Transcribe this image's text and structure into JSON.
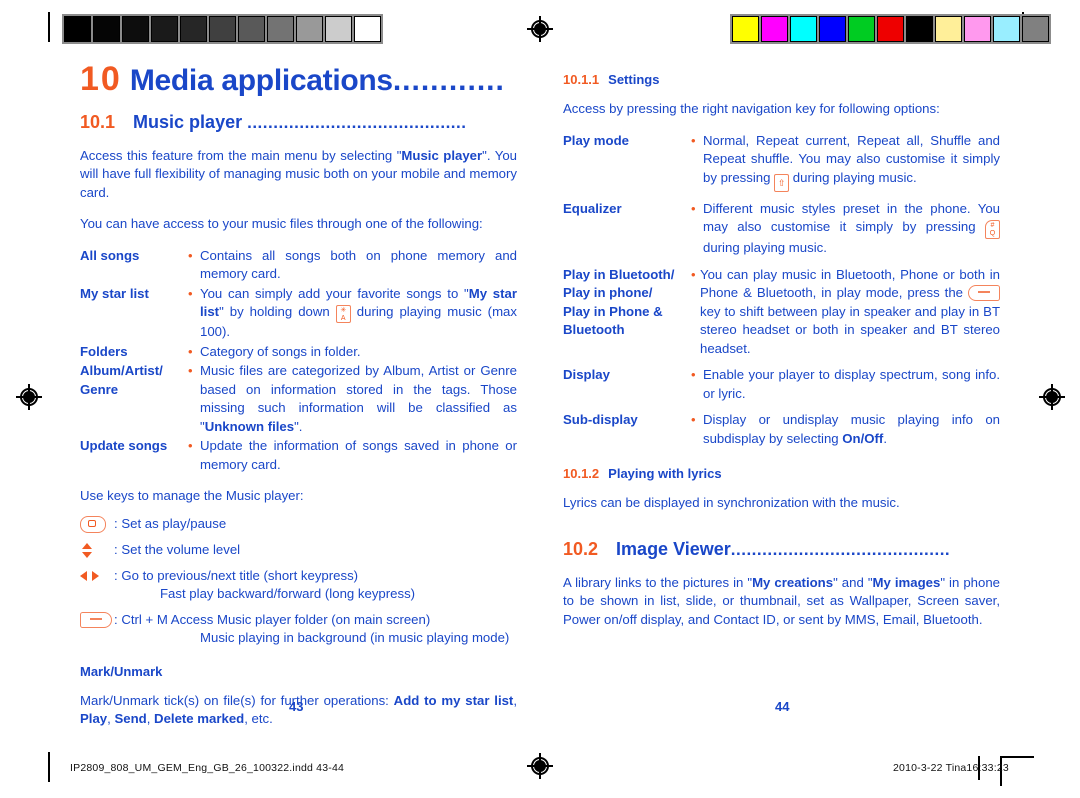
{
  "document": {
    "chapter_number": "10",
    "chapter_title": "Media applications",
    "chapter_dots": "............",
    "page_left": "43",
    "page_right": "44"
  },
  "colors": {
    "accent_orange": "#f15a22",
    "body_blue": "#1a47c8",
    "key_outline": "#f4845c"
  },
  "sections": {
    "music_player": {
      "number": "10.1",
      "title": "Music player",
      "dots": "..........................................",
      "intro_1_a": "Access this feature from the main menu by selecting \"",
      "intro_1_b": "Music player",
      "intro_1_c": "\". You will have full flexibility of managing music both on your mobile and memory card.",
      "intro_2": "You can have access to your music files through one of the following:",
      "items": [
        {
          "term": "All songs",
          "desc": "Contains all songs both on phone memory and memory card."
        },
        {
          "term": "My star list",
          "desc_a": "You can simply add your favorite songs to \"",
          "desc_b": "My star list",
          "desc_c": "\" by holding down ",
          "key": "star-a-key",
          "desc_d": " during playing music (max 100)."
        },
        {
          "term": "Folders",
          "desc": "Category of songs in folder."
        },
        {
          "term": "Album/Artist/ Genre",
          "term_line1": "Album/Artist/",
          "term_line2": "Genre",
          "desc_a": "Music files are categorized by Album, Artist or Genre based on information stored in the tags. Those missing such information will be classified as \"",
          "desc_b": "Unknown files",
          "desc_c": "\"."
        },
        {
          "term": "Update songs",
          "desc": "Update the information of songs saved in phone or memory card."
        }
      ],
      "keys_intro": "Use keys to manage the Music player:",
      "keys": [
        {
          "icon": "ok-key-icon",
          "label": ": Set as play/pause"
        },
        {
          "icon": "volume-updown-icon",
          "label": ": Set the volume level"
        },
        {
          "icon": "prev-next-arrows-icon",
          "label": ": Go to previous/next title (short keypress)",
          "label_line2": "Fast play backward/forward (long keypress)"
        },
        {
          "icon": "soft-key-icon",
          "label": ": Ctrl + M Access Music player folder (on main screen)",
          "label_line2": "Music playing in background (in music playing mode)"
        }
      ],
      "mark_unmark_title": "Mark/Unmark",
      "mark_unmark_a": "Mark/Unmark tick(s) on file(s) for further operations: ",
      "mark_unmark_b": "Add to my star list",
      "mark_unmark_c": ", ",
      "mark_unmark_d": "Play",
      "mark_unmark_e": ", ",
      "mark_unmark_f": "Send",
      "mark_unmark_g": ", ",
      "mark_unmark_h": "Delete marked",
      "mark_unmark_i": ", etc."
    },
    "settings": {
      "number": "10.1.1",
      "title": "Settings",
      "intro": "Access by pressing the right navigation key for following options:",
      "items": [
        {
          "term": "Play mode",
          "desc_a": "Normal, Repeat current, Repeat all, Shuffle and Repeat shuffle. You may also customise it simply by pressing ",
          "key": "shift-key-icon",
          "desc_b": " during playing music."
        },
        {
          "term": "Equalizer",
          "desc_a": "Different music styles preset in the phone. You may also customise it simply by pressing ",
          "key": "hash-q-key-icon",
          "desc_b": " during playing music."
        },
        {
          "term_line1": "Play in Bluetooth/",
          "term_line2": "Play in phone/",
          "term_line3": "Play in Phone &",
          "term_line4": "Bluetooth",
          "desc_a": "You can play music in Bluetooth, Phone or both in Phone & Bluetooth, in play mode, press the ",
          "key": "soft-key-icon",
          "desc_b": " key to shift between play in speaker and play in BT stereo headset or both in speaker and BT stereo headset."
        },
        {
          "term": "Display",
          "desc": "Enable your player to display spectrum, song info. or lyric."
        },
        {
          "term": "Sub-display",
          "desc_a": "Display or undisplay music playing info on subdisplay by selecting ",
          "desc_b": "On/Off",
          "desc_c": "."
        }
      ]
    },
    "lyrics": {
      "number": "10.1.2",
      "title": "Playing with lyrics",
      "body": "Lyrics can be displayed in synchronization with the music."
    },
    "image_viewer": {
      "number": "10.2",
      "title": "Image Viewer",
      "dots": "..........................................",
      "body_a": "A library links to the pictures in \"",
      "body_b": "My creations",
      "body_c": "\" and \"",
      "body_d": "My images",
      "body_e": "\" in phone to be shown in list, slide, or thumbnail, set as Wallpaper, Screen saver, Power on/off display, and Contact ID, or sent by MMS, Email, Bluetooth."
    }
  },
  "print_marks": {
    "grayscale_bar": [
      "#000000",
      "#050505",
      "#0d0d0d",
      "#1a1a1a",
      "#262626",
      "#404040",
      "#595959",
      "#737373",
      "#999999",
      "#cccccc",
      "#ffffff"
    ],
    "color_bar": [
      "#ffff00",
      "#ff00ff",
      "#00ffff",
      "#0000ff",
      "#00cc22",
      "#ee0000",
      "#000000",
      "#ffef99",
      "#ff99ee",
      "#99eeff",
      "#808080"
    ]
  },
  "footer": {
    "filename": "IP2809_808_UM_GEM_Eng_GB_26_100322.indd   43-44",
    "timestamp": "2010-3-22   Tina16:33:23"
  }
}
